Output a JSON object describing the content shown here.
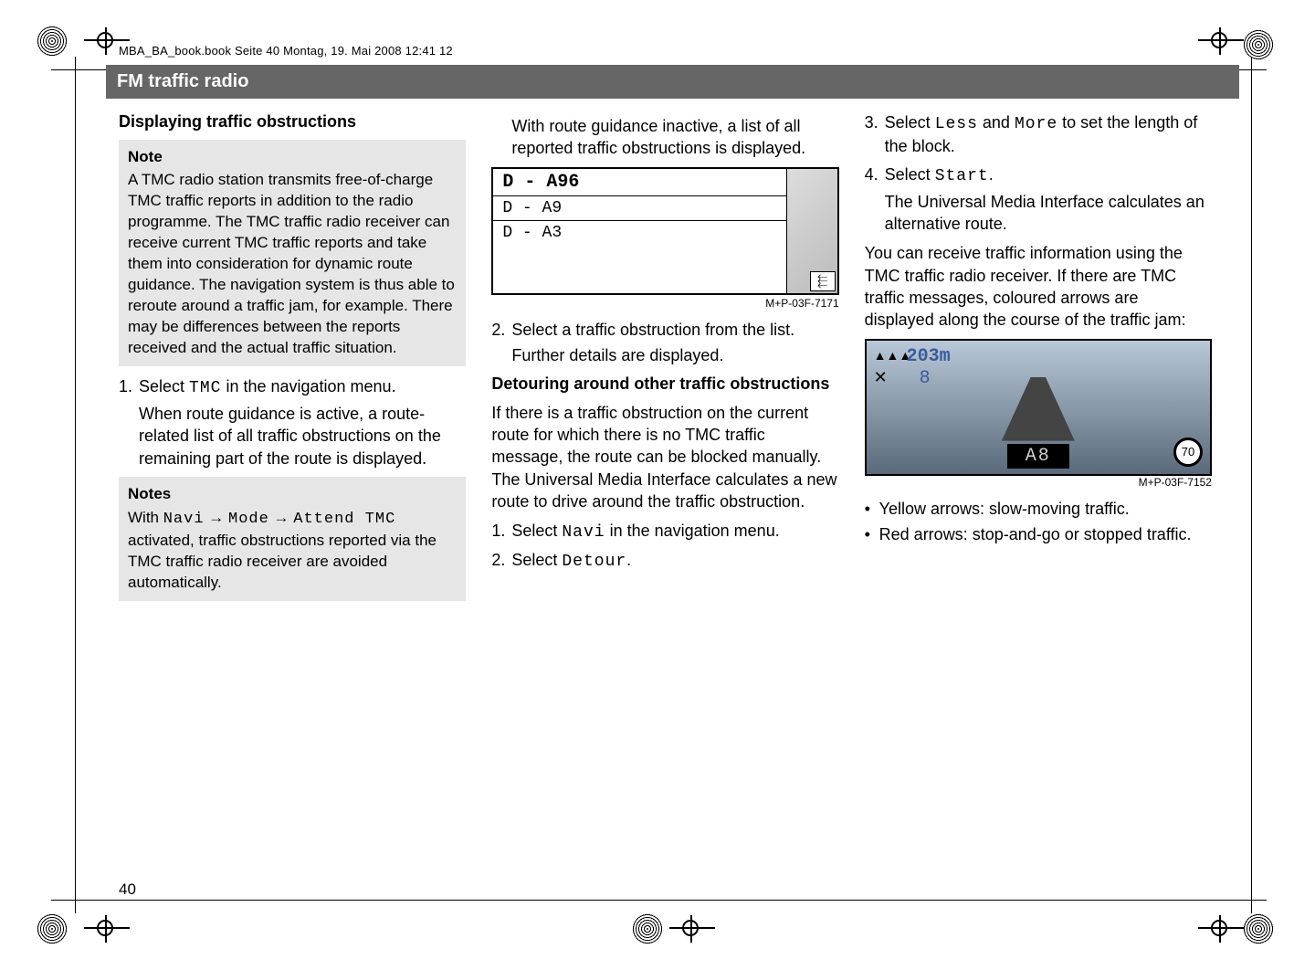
{
  "header": "MBA_BA_book.book  Seite 40  Montag, 19. Mai 2008  12:41 12",
  "title": "FM traffic radio",
  "page_number": "40",
  "col1": {
    "h_displaying": "Displaying traffic obstructions",
    "note1_head": "Note",
    "note1_body": "A TMC radio station transmits free-of-charge TMC traffic reports in addition to the radio programme. The TMC traffic radio receiver can receive current TMC traffic reports and take them into consideration for dynamic route guidance. The navigation system is thus able to reroute around a traffic jam, for example. There may be differences between the reports received and the actual traffic situation.",
    "step1_a": "Select ",
    "step1_mono": "TMC",
    "step1_b": " in the navigation menu.",
    "step1_sub": "When route guidance is active, a route-related list of all traffic obstructions on the remaining part of the route is displayed.",
    "notes2_head": "Notes",
    "notes2_a": "With ",
    "notes2_m1": "Navi",
    "notes2_m2": "Mode",
    "notes2_m3": "Attend TMC",
    "notes2_c": " activated, traffic obstructions reported via the TMC traffic radio receiver are avoided automatically."
  },
  "col2": {
    "intro": "With route guidance inactive, a list of all reported traffic obstructions is displayed.",
    "list": [
      "D - A96",
      "D - A9",
      "D - A3"
    ],
    "back_glyph": "⬱",
    "img1_label": "M+P-03F-7171",
    "step2": "Select a traffic obstruction from the list.",
    "step2_sub": "Further details are displayed.",
    "h_detour": "Detouring around other traffic obstructions",
    "detour_body": "If there is a traffic obstruction on the current route for which there is no TMC traffic message, the route can be blocked manually. The Universal Media Interface calculates a new route to drive around the traffic obstruction.",
    "dstep1_a": "Select ",
    "dstep1_m": "Navi",
    "dstep1_b": " in the navigation menu.",
    "dstep2_a": "Select ",
    "dstep2_m": "Detour",
    "dstep2_b": "."
  },
  "col3": {
    "dstep3_a": "Select ",
    "dstep3_m1": "Less",
    "dstep3_mid": " and ",
    "dstep3_m2": "More",
    "dstep3_b": " to set the length of the block.",
    "dstep4_a": "Select ",
    "dstep4_m": "Start",
    "dstep4_b": ".",
    "dstep4_sub": "The Universal Media Interface calculates an alternative route.",
    "tmc_body": "You can receive traffic information using the TMC traffic radio receiver. If there are TMC traffic messages, coloured arrows are displayed along the course of the traffic jam:",
    "nav_dist": "203m",
    "nav_tri": "▲▲▲",
    "nav_num": "8",
    "nav_sat": "✕",
    "nav_road": "A8",
    "nav_speed": "70",
    "img2_label": "M+P-03F-7152",
    "b1": "Yellow arrows: slow-moving traffic.",
    "b2": "Red arrows: stop-and-go or stopped traffic."
  }
}
